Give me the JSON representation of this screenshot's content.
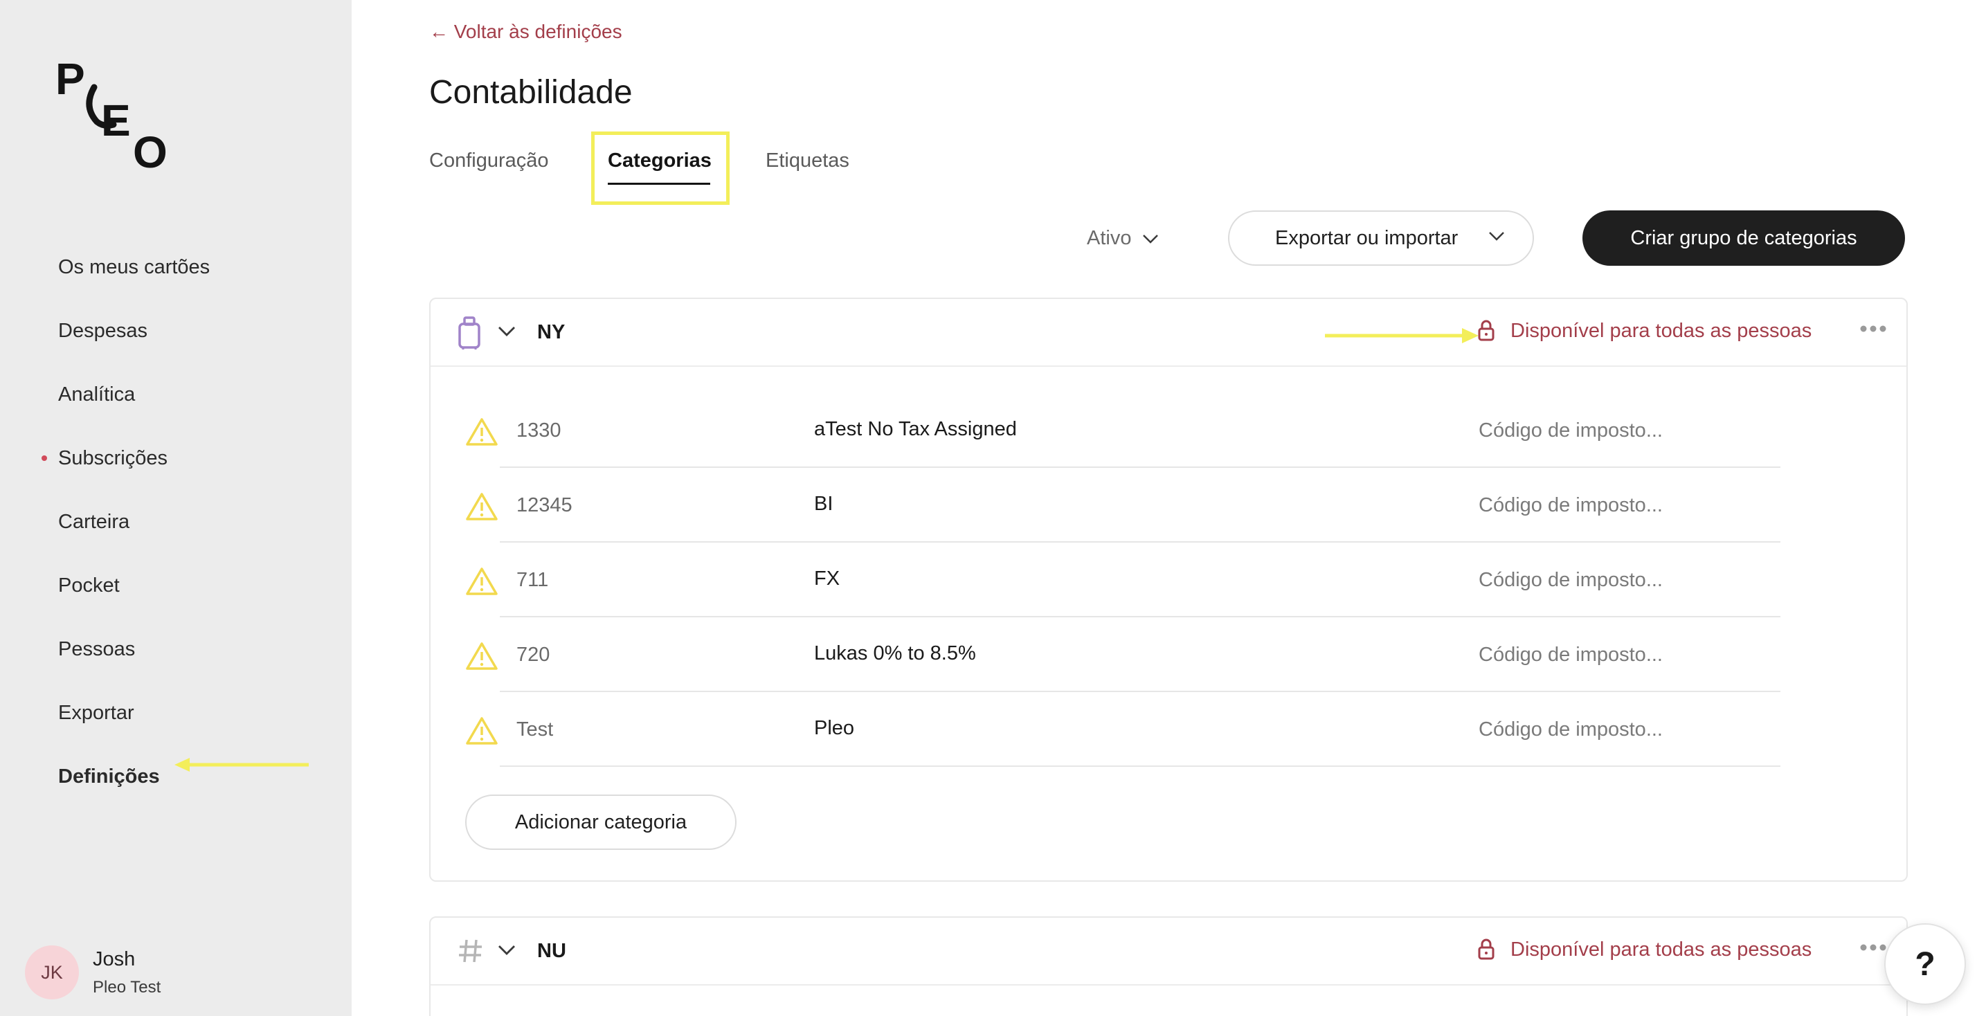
{
  "brand": {
    "logo_text": "PLEO"
  },
  "sidebar": {
    "items": [
      {
        "label": "Os meus cartões"
      },
      {
        "label": "Despesas"
      },
      {
        "label": "Analítica"
      },
      {
        "label": "Subscrições",
        "has_dot": true
      },
      {
        "label": "Carteira"
      },
      {
        "label": "Pocket"
      },
      {
        "label": "Pessoas"
      },
      {
        "label": "Exportar"
      },
      {
        "label": "Definições",
        "active": true
      }
    ]
  },
  "user": {
    "initials": "JK",
    "name": "Josh",
    "company": "Pleo Test"
  },
  "main": {
    "back_link": "← Voltar às definições",
    "title": "Contabilidade",
    "tabs": [
      {
        "label": "Configuração"
      },
      {
        "label": "Categorias",
        "active": true
      },
      {
        "label": "Etiquetas"
      }
    ],
    "filter_label": "Ativo",
    "export_label": "Exportar ou importar",
    "create_label": "Criar grupo de categorias"
  },
  "groups": [
    {
      "name": "NY",
      "icon": "suitcase-icon",
      "availability": "Disponível para todas as pessoas",
      "categories": [
        {
          "code": "1330",
          "name": "aTest No Tax Assigned",
          "tax": "Código de imposto..."
        },
        {
          "code": "12345",
          "name": "BI",
          "tax": "Código de imposto..."
        },
        {
          "code": "711",
          "name": "FX",
          "tax": "Código de imposto..."
        },
        {
          "code": "720",
          "name": "Lukas 0% to 8.5%",
          "tax": "Código de imposto..."
        },
        {
          "code": "Test",
          "name": "Pleo",
          "tax": "Código de imposto..."
        }
      ],
      "add_label": "Adicionar categoria"
    },
    {
      "name": "NU",
      "icon": "hash-icon",
      "availability": "Disponível para todas as pessoas"
    }
  ],
  "help": {
    "label": "?"
  },
  "colors": {
    "accent": "#a33e4a",
    "highlight": "#f3ee5a",
    "warning": "#f2d94e",
    "primary_button": "#1f1f1f",
    "sidebar_bg": "#ececec"
  }
}
